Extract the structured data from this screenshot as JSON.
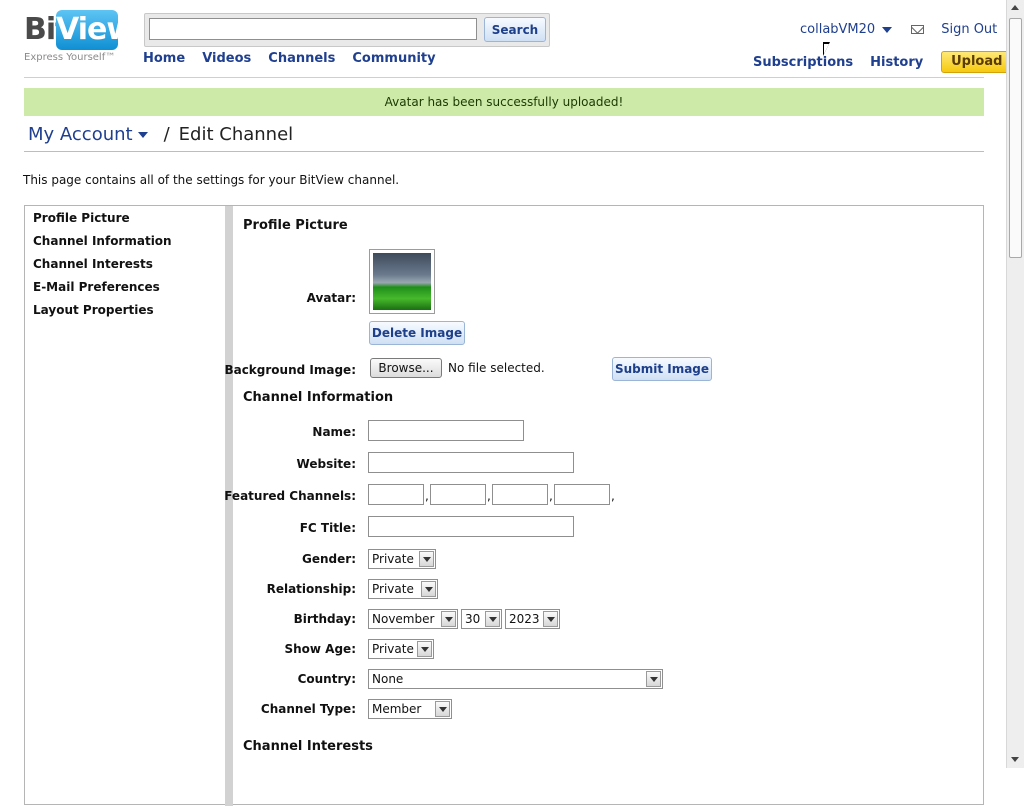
{
  "header": {
    "logo_bit": "Bit",
    "logo_view": "View",
    "logo_tagline": "Express Yourself™",
    "search_placeholder": "",
    "search_button": "Search",
    "nav": [
      "Home",
      "Videos",
      "Channels",
      "Community"
    ],
    "username": "collabVM20",
    "sign_out": "Sign Out",
    "subscriptions": "Subscriptions",
    "history": "History",
    "upload": "Upload"
  },
  "banner": "Avatar has been successfully uploaded!",
  "breadcrumb": {
    "account": "My Account",
    "separator": "/",
    "page": "Edit Channel"
  },
  "intro": "This page contains all of the settings for your BitView channel.",
  "sidebar": [
    "Profile Picture",
    "Channel Information",
    "Channel Interests",
    "E-Mail Preferences",
    "Layout Properties"
  ],
  "profile_picture": {
    "title": "Profile Picture",
    "avatar_label": "Avatar:",
    "delete_button": "Delete Image",
    "background_label": "Background Image:",
    "browse_button": "Browse...",
    "no_file": "No file selected.",
    "submit_button": "Submit Image"
  },
  "channel_information": {
    "title": "Channel Information",
    "name_label": "Name:",
    "name_value": "",
    "website_label": "Website:",
    "website_value": "",
    "featured_label": "Featured Channels:",
    "comma": ",",
    "fc_title_label": "FC Title:",
    "fc_title_value": "",
    "gender_label": "Gender:",
    "gender_value": "Private",
    "relationship_label": "Relationship:",
    "relationship_value": "Private",
    "birthday_label": "Birthday:",
    "birthday_month": "November",
    "birthday_day": "30",
    "birthday_year": "2023",
    "show_age_label": "Show Age:",
    "show_age_value": "Private",
    "country_label": "Country:",
    "country_value": "None",
    "channel_type_label": "Channel Type:",
    "channel_type_value": "Member"
  },
  "channel_interests": {
    "title": "Channel Interests"
  },
  "colors": {
    "link": "#1f3f8f",
    "banner_bg": "#cdeaa9",
    "upload_bg": "#f6c90e"
  }
}
